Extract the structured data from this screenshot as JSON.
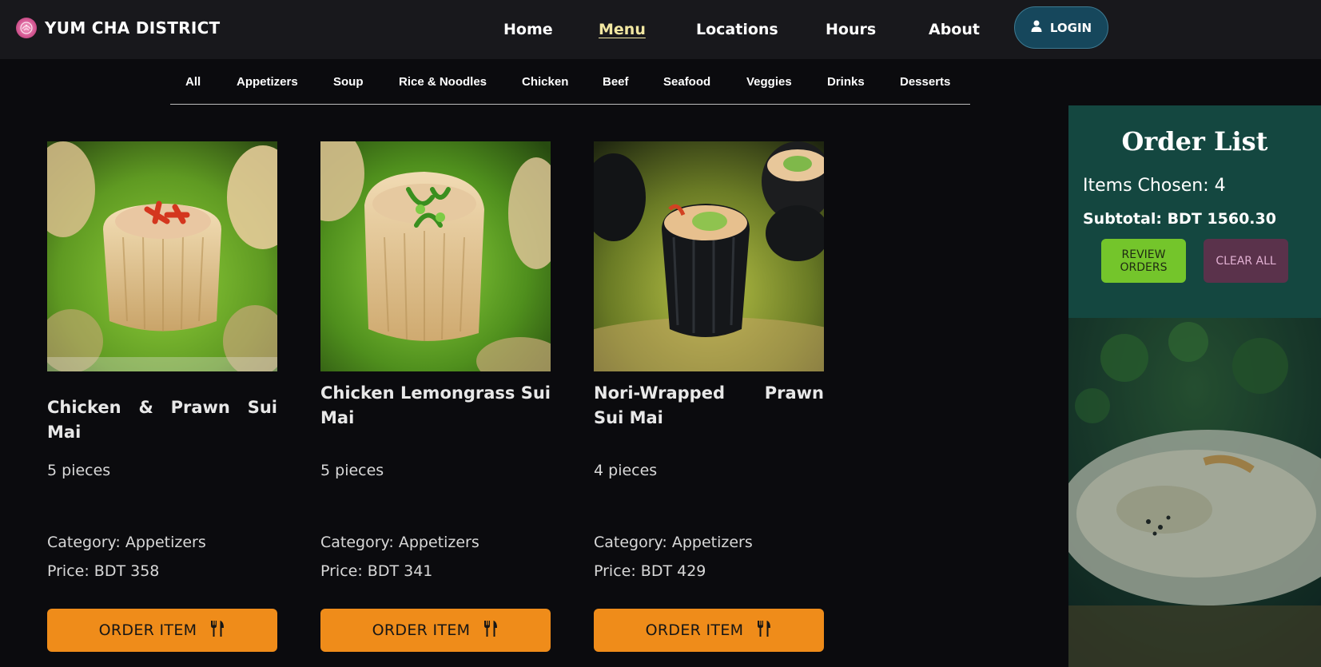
{
  "brand": {
    "name": "YUM CHA DISTRICT",
    "logo_icon": "dumpling-logo-icon"
  },
  "nav": {
    "items": [
      {
        "label": "Home"
      },
      {
        "label": "Menu",
        "active": true
      },
      {
        "label": "Locations"
      },
      {
        "label": "Hours"
      },
      {
        "label": "About"
      }
    ],
    "login_label": "LOGIN",
    "login_icon": "user-icon"
  },
  "categories": [
    "All",
    "Appetizers",
    "Soup",
    "Rice & Noodles",
    "Chicken",
    "Beef",
    "Seafood",
    "Veggies",
    "Drinks",
    "Desserts"
  ],
  "menu_items": [
    {
      "name": "Chicken & Prawn Sui Mai",
      "pieces": "5 pieces",
      "category": "Category: Appetizers",
      "price": "Price: BDT 358",
      "button": "ORDER ITEM"
    },
    {
      "name": "Chicken Lemongrass Sui Mai",
      "pieces": "5 pieces",
      "category": "Category: Appetizers",
      "price": "Price: BDT 341",
      "button": "ORDER ITEM"
    },
    {
      "name": "Nori-Wrapped Prawn Sui Mai",
      "pieces": "4 pieces",
      "category": "Category: Appetizers",
      "price": "Price: BDT 429",
      "button": "ORDER ITEM"
    }
  ],
  "order_list": {
    "title": "Order List",
    "items_chosen": "Items Chosen: 4",
    "subtotal": "Subtotal: BDT 1560.30",
    "review_label": "REVIEW ORDERS",
    "clear_label": "CLEAR ALL"
  },
  "colors": {
    "header_bg": "#18181c",
    "page_bg": "#0b0b0e",
    "accent_orange": "#ef8c1a",
    "active_nav": "#f2e7a2",
    "panel_teal": "#144740",
    "review_green": "#74c52b",
    "clear_plum": "#5a324b",
    "login_blue": "#16475c"
  }
}
